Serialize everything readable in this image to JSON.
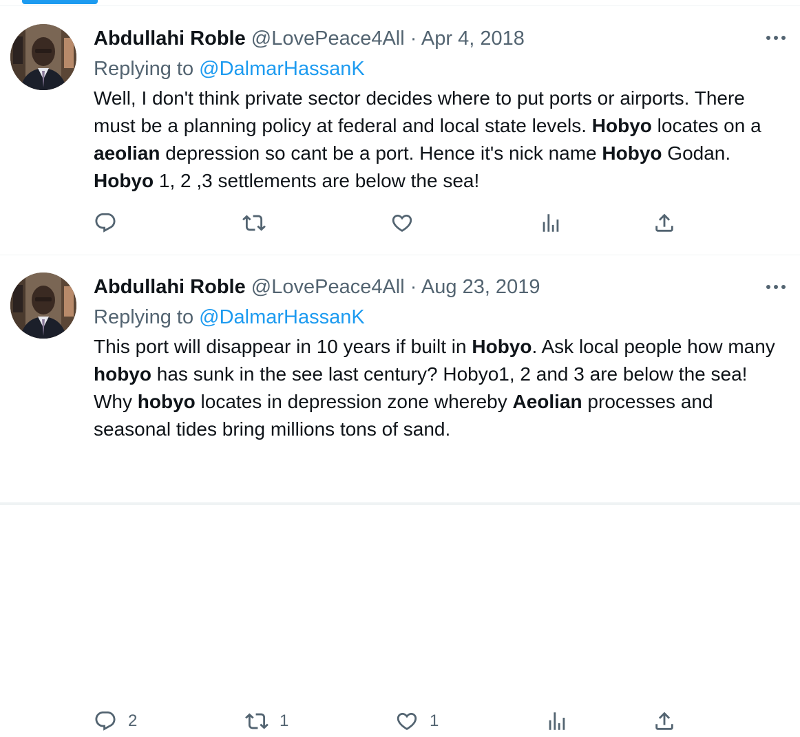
{
  "tweets": [
    {
      "author_name": "Abdullahi Roble",
      "handle": "@LovePeace4All",
      "separator": "·",
      "date": "Apr 4, 2018",
      "replying_prefix": "Replying to",
      "replying_to": "@DalmarHassanK",
      "text_parts": [
        {
          "t": "Well, I don't think private sector decides where to put ports or airports. There must be a planning policy at federal and local state levels. ",
          "b": false
        },
        {
          "t": "Hobyo",
          "b": true
        },
        {
          "t": " locates on a ",
          "b": false
        },
        {
          "t": "aeolian",
          "b": true
        },
        {
          "t": " depression so cant be a port. Hence it's nick name ",
          "b": false
        },
        {
          "t": "Hobyo",
          "b": true
        },
        {
          "t": " Godan. ",
          "b": false
        },
        {
          "t": "Hobyo",
          "b": true
        },
        {
          "t": " 1, 2 ,3 settlements are below the sea!",
          "b": false
        }
      ],
      "counts": {
        "replies": "",
        "retweets": "",
        "likes": ""
      }
    },
    {
      "author_name": "Abdullahi Roble",
      "handle": "@LovePeace4All",
      "separator": "·",
      "date": "Aug 23, 2019",
      "replying_prefix": "Replying to",
      "replying_to": "@DalmarHassanK",
      "text_parts": [
        {
          "t": "This port will disappear in 10 years if built in ",
          "b": false
        },
        {
          "t": "Hobyo",
          "b": true
        },
        {
          "t": ". Ask local people how many ",
          "b": false
        },
        {
          "t": "hobyo",
          "b": true
        },
        {
          "t": " has sunk in the see last century? Hobyo1, 2 and 3 are below the sea! Why ",
          "b": false
        },
        {
          "t": "hobyo",
          "b": true
        },
        {
          "t": " locates in depression zone whereby ",
          "b": false
        },
        {
          "t": "Aeolian",
          "b": true
        },
        {
          "t": " processes and seasonal tides bring millions tons of sand.",
          "b": false
        }
      ],
      "counts": {
        "replies": "2",
        "retweets": "1",
        "likes": "1"
      }
    }
  ],
  "icons": {
    "reply": "reply-icon",
    "retweet": "retweet-icon",
    "like": "heart-icon",
    "views": "views-icon",
    "share": "share-icon",
    "more": "more-icon"
  },
  "colors": {
    "text": "#0f1419",
    "secondary": "#536471",
    "accent": "#1d9bf0",
    "divider": "#eff3f4"
  }
}
